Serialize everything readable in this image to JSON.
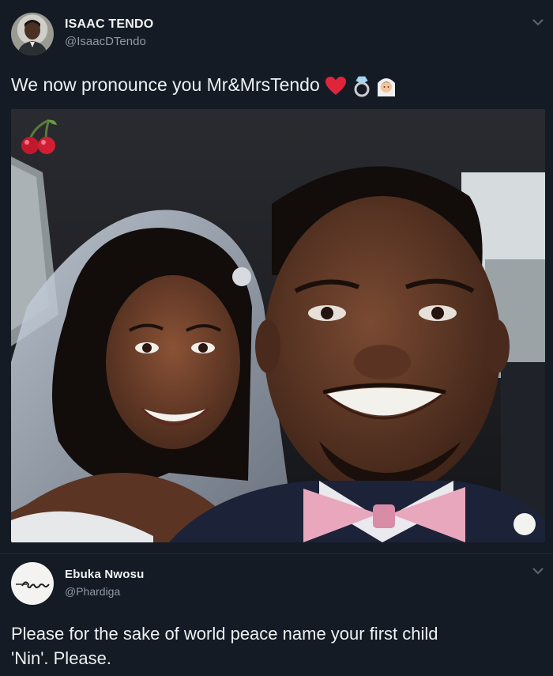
{
  "tweet1": {
    "display_name": "ISAAC TENDO",
    "handle": "@IsaacDTendo",
    "text": "We now pronounce you Mr&MrsTendo",
    "emojis": [
      "red-heart-icon",
      "ring-icon",
      "bride-with-veil-icon"
    ],
    "photo_sticker": "cherries-icon"
  },
  "tweet2": {
    "display_name": "Ebuka Nwosu",
    "handle": "@Phardiga",
    "text_line1": "Please for the sake of world peace name your first child",
    "text_line2": "'Nin'. Please.",
    "avatar_signature": "en"
  },
  "colors": {
    "background": "#141b24",
    "handle": "#8f98a4",
    "text": "#eef1f4"
  }
}
